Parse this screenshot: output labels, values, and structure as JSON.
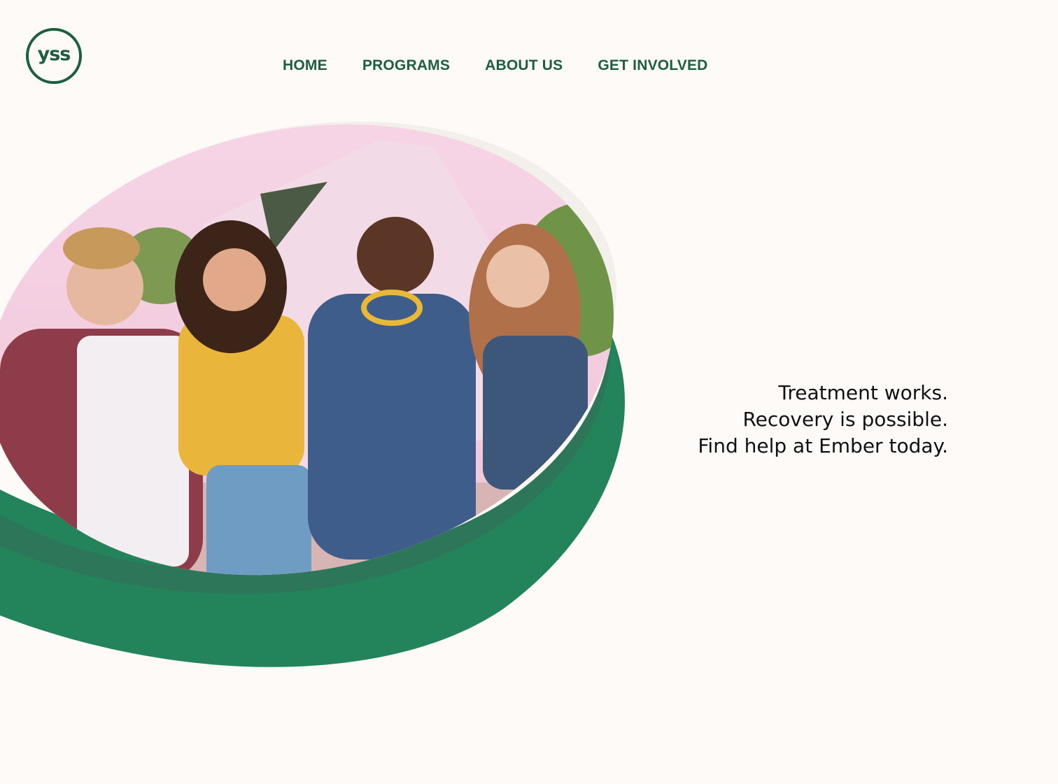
{
  "brand": {
    "logo_text": "yss",
    "primary_color": "#1d5e41",
    "accent_green": "#23835a",
    "background": "#fdfaf7"
  },
  "nav": {
    "items": [
      {
        "label": "HOME"
      },
      {
        "label": "PROGRAMS"
      },
      {
        "label": "ABOUT US"
      },
      {
        "label": "GET INVOLVED"
      }
    ]
  },
  "hero": {
    "tagline_lines": [
      "Treatment works.",
      "Recovery is possible.",
      "Find help at Ember today."
    ]
  }
}
